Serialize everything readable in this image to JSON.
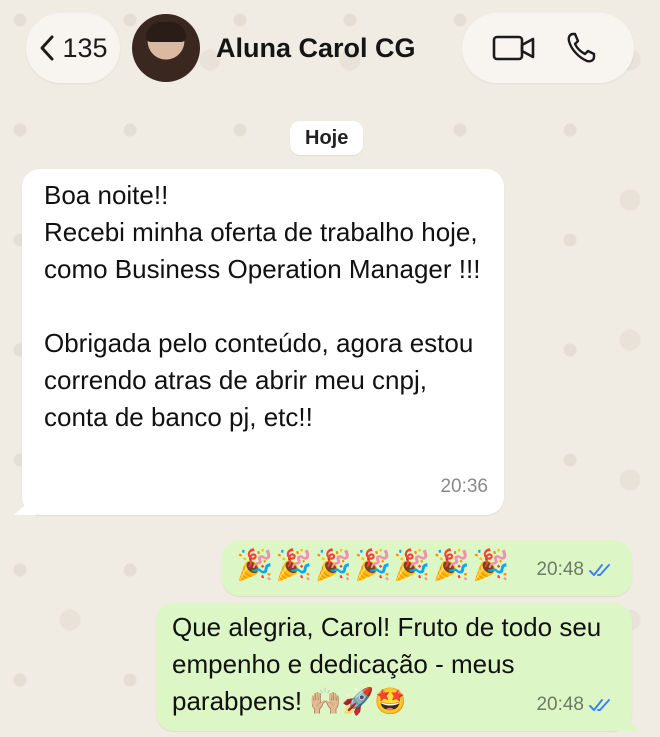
{
  "header": {
    "back_count": "135",
    "contact_name": "Aluna Carol CG"
  },
  "date_chip": "Hoje",
  "messages": [
    {
      "direction": "incoming",
      "text": "Boa noite!!\nRecebi minha oferta de trabalho hoje, como Business Operation Manager !!!\n\nObrigada pelo conteúdo, agora estou correndo atras de abrir meu cnpj, conta de banco pj, etc!!",
      "time": "20:36"
    },
    {
      "direction": "outgoing",
      "text": "🎉🎉🎉🎉🎉🎉🎉",
      "time": "20:48",
      "status": "read"
    },
    {
      "direction": "outgoing",
      "text": "Que alegria, Carol! Fruto de todo seu empenho e dedicação - meus parabpens! 🙌🏼🚀🤩",
      "time": "20:48",
      "status": "read"
    }
  ],
  "colors": {
    "outgoing_bubble": "#dcf7c5",
    "incoming_bubble": "#ffffff",
    "read_ticks": "#3b82f6"
  },
  "icons": [
    "chevron-left-icon",
    "video-call-icon",
    "phone-icon",
    "double-check-icon"
  ]
}
